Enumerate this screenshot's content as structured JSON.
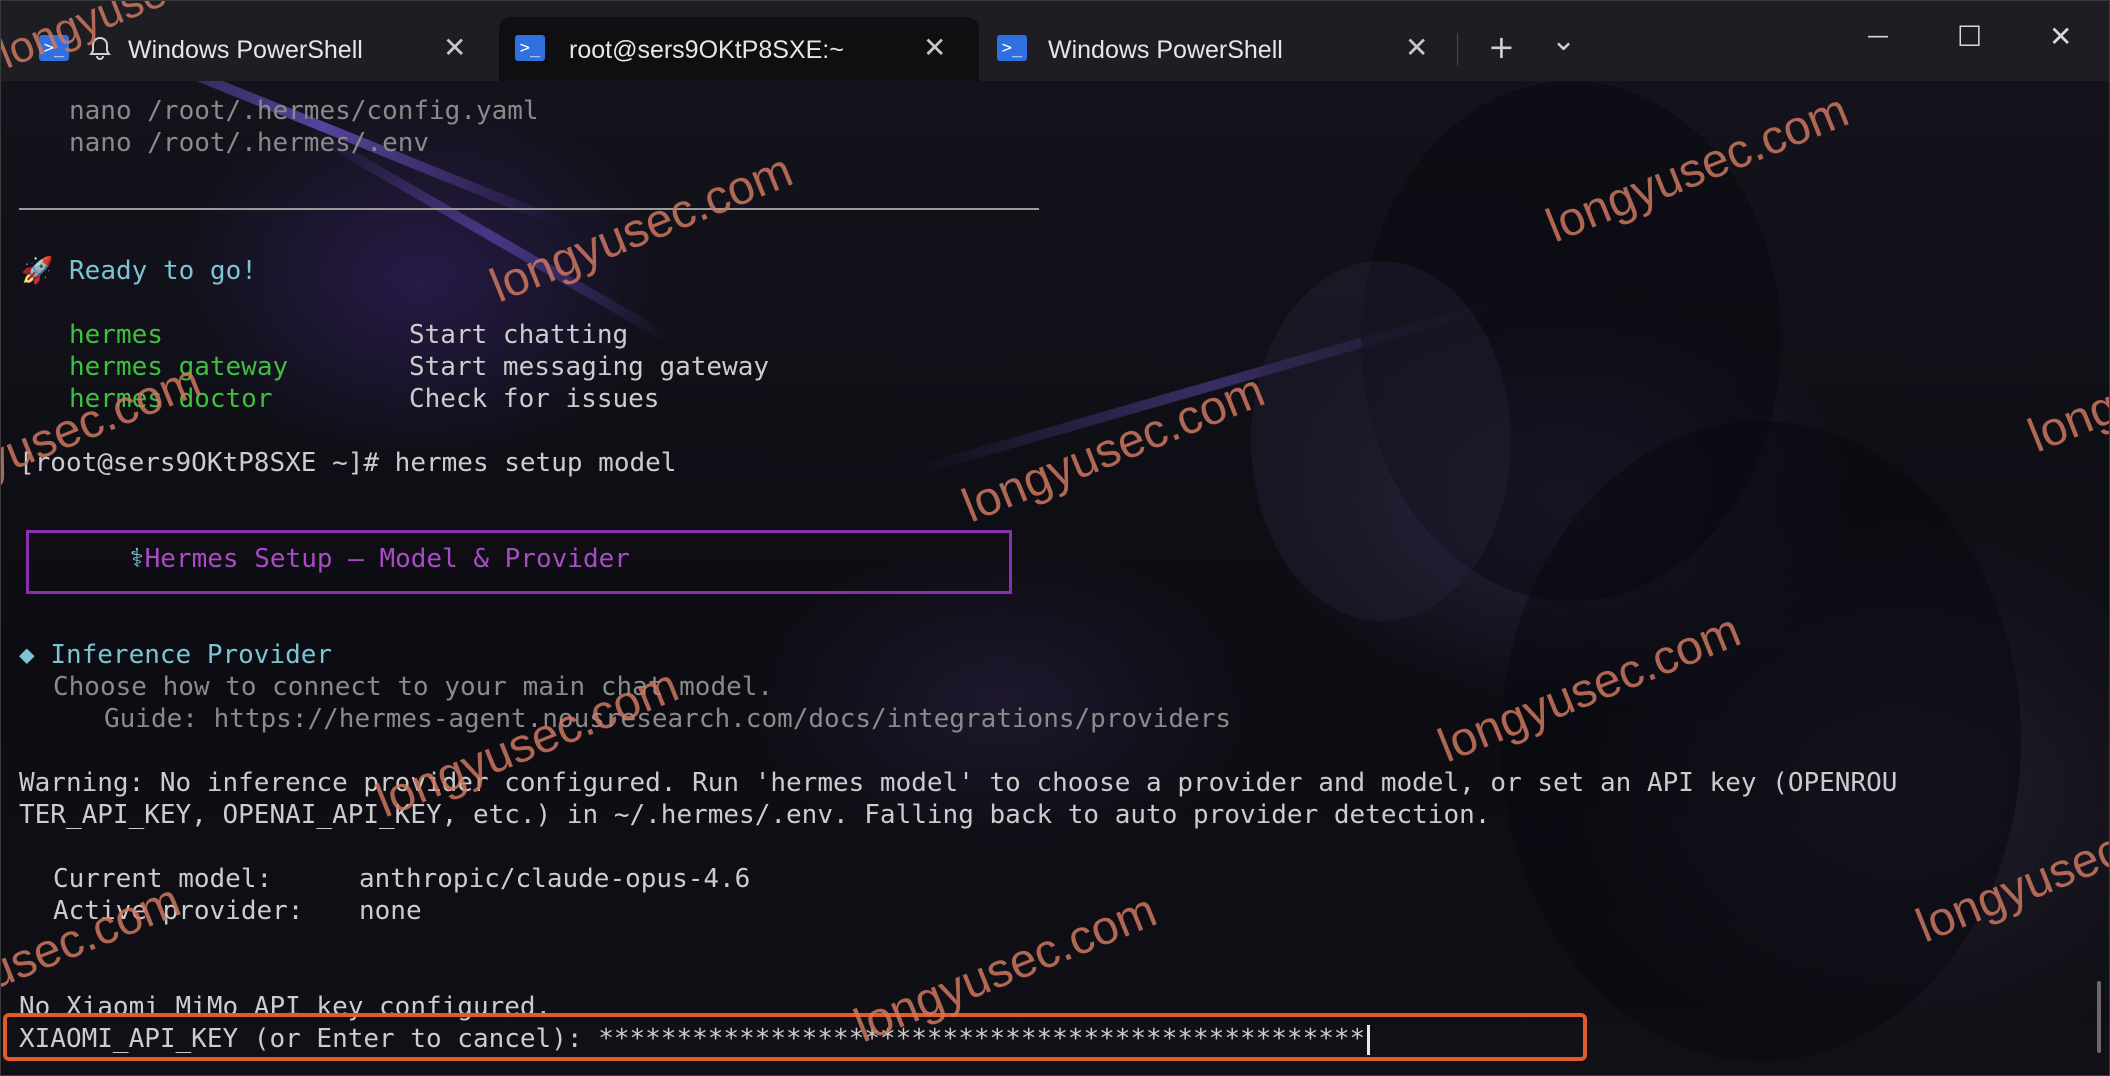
{
  "tabs": [
    {
      "label": "Windows PowerShell",
      "icon": "powershell-icon",
      "badge_icon": "bell-icon"
    },
    {
      "label": "root@sers9OKtP8SXE:~",
      "icon": "powershell-icon",
      "active": true
    },
    {
      "label": "Windows PowerShell",
      "icon": "powershell-icon"
    }
  ],
  "titlebar": {
    "new_tab": "+",
    "dropdown": "⌄",
    "minimize": "—",
    "maximize": "☐",
    "close": "✕",
    "tab_close": "✕"
  },
  "terminal": {
    "config_line1": "nano /root/.hermes/config.yaml",
    "config_line2": "nano /root/.hermes/.env",
    "ready_emoji": "🚀",
    "ready_text": "Ready to go!",
    "commands": [
      {
        "cmd": "hermes",
        "desc": "Start chatting"
      },
      {
        "cmd": "hermes gateway",
        "desc": "Start messaging gateway"
      },
      {
        "cmd": "hermes doctor",
        "desc": "Check for issues"
      }
    ],
    "prompt": "[root@sers9OKtP8SXE ~]# hermes setup model",
    "setup_icon": "⚕",
    "setup_title": "Hermes Setup — Model & Provider",
    "section_bullet": "◆",
    "section_title": "Inference Provider",
    "section_desc": "Choose how to connect to your main chat model.",
    "guide": "Guide: https://hermes-agent.nousresearch.com/docs/integrations/providers",
    "warning_line1": "Warning: No inference provider configured. Run 'hermes model' to choose a provider and model, or set an API key (OPENROU",
    "warning_line2": "TER_API_KEY, OPENAI_API_KEY, etc.) in ~/.hermes/.env. Falling back to auto provider detection.",
    "current_model_label": "Current model:",
    "current_model_value": "anthropic/claude-opus-4.6",
    "active_provider_label": "Active provider:",
    "active_provider_value": "none",
    "no_key_msg": "No Xiaomi MiMo API key configured.",
    "api_key_prompt": "XIAOMI_API_KEY (or Enter to cancel): ",
    "api_key_masked": "*************************************************"
  },
  "watermark": {
    "text": "longyusec.com",
    "color": "#cd785f"
  },
  "colors": {
    "accent_highlight": "#e05a2a",
    "box_border": "#8a2fb0",
    "green": "#3fbf3f",
    "cyan": "#7cc4d4"
  }
}
